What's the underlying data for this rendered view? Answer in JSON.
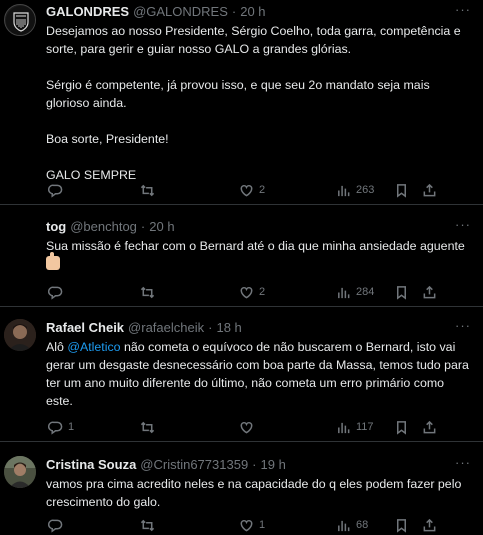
{
  "tweets": [
    {
      "name": "GALONDRES",
      "handle": "@GALONDRES",
      "time": "20 h",
      "paragraphs": [
        "Desejamos ao nosso Presidente, Sérgio Coelho, toda garra, competência e sorte, para gerir e guiar nosso GALO a grandes glórias.",
        "Sérgio é competente, já provou isso, e que seu 2o mandato seja mais glorioso ainda.",
        "Boa sorte, Presidente!",
        "GALO SEMPRE"
      ],
      "replies": "",
      "reposts": "",
      "likes": "2",
      "views": "263"
    },
    {
      "name": "tog",
      "handle": "@benchtog",
      "time": "20 h",
      "text": "Sua missão é fechar com o Bernard até o dia que minha ansiedade aguente",
      "emoji": "thumbs-up",
      "replies": "",
      "reposts": "",
      "likes": "2",
      "views": "284"
    },
    {
      "name": "Rafael Cheik",
      "handle": "@rafaelcheik",
      "time": "18 h",
      "text_pre": "Alô ",
      "mention": "@Atletico",
      "text_post": " não cometa o equívoco de não buscarem o Bernard, isto vai gerar um desgaste desnecessário com boa parte da Massa, temos tudo para ter um ano muito diferente do último, não cometa um erro primário como este.",
      "replies": "1",
      "reposts": "",
      "likes": "",
      "views": "117"
    },
    {
      "name": "Cristina Souza",
      "handle": "@Cristin67731359",
      "time": "19 h",
      "text": "vamos pra cima acredito neles e na capacidade do q eles podem fazer pelo crescimento do galo.",
      "replies": "",
      "reposts": "",
      "likes": "1",
      "views": "68"
    }
  ],
  "separator": "·",
  "more_glyph": "···",
  "colors": {
    "background": "#000000",
    "text": "#e7e9ea",
    "muted": "#71767b",
    "border": "#2f3336",
    "link": "#1d9bf0"
  }
}
